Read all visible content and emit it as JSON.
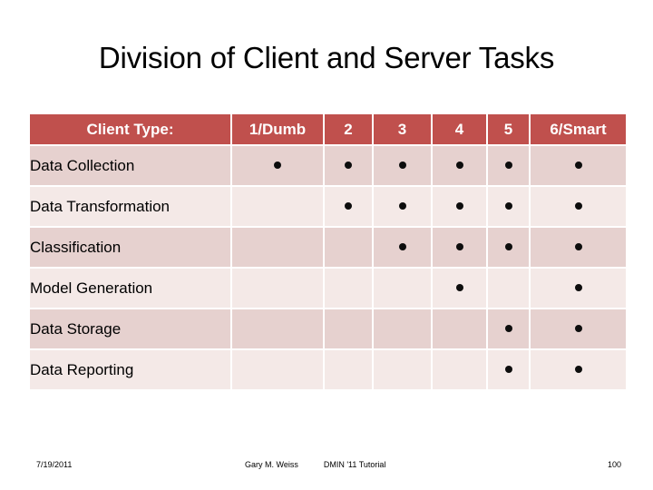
{
  "slide": {
    "title": "Division of Client and Server Tasks",
    "accent_color": "#C0504D",
    "band_dark_color": "#E6D1CF",
    "band_light_color": "#F4E9E7",
    "dot_color": "#0D0D0D"
  },
  "table": {
    "headers": [
      "Client Type:",
      "1/Dumb",
      "2",
      "3",
      "4",
      "5",
      "6/Smart"
    ],
    "rows": [
      {
        "label": "Data Collection",
        "marks": [
          "●",
          "●",
          "●",
          "●",
          "●",
          "●"
        ]
      },
      {
        "label": "Data Transformation",
        "marks": [
          "",
          "●",
          "●",
          "●",
          "●",
          "●"
        ]
      },
      {
        "label": "Classification",
        "marks": [
          "",
          "",
          "●",
          "●",
          "●",
          "●"
        ]
      },
      {
        "label": "Model Generation",
        "marks": [
          "",
          "",
          "",
          "●",
          "",
          "●"
        ]
      },
      {
        "label": "Data Storage",
        "marks": [
          "",
          "",
          "",
          "",
          "●",
          "●"
        ]
      },
      {
        "label": "Data Reporting",
        "marks": [
          "",
          "",
          "",
          "",
          "●",
          "●"
        ]
      }
    ]
  },
  "footer": {
    "date": "7/19/2011",
    "author": "Gary M. Weiss",
    "event": "DMIN '11 Tutorial",
    "slide_number": "100"
  }
}
